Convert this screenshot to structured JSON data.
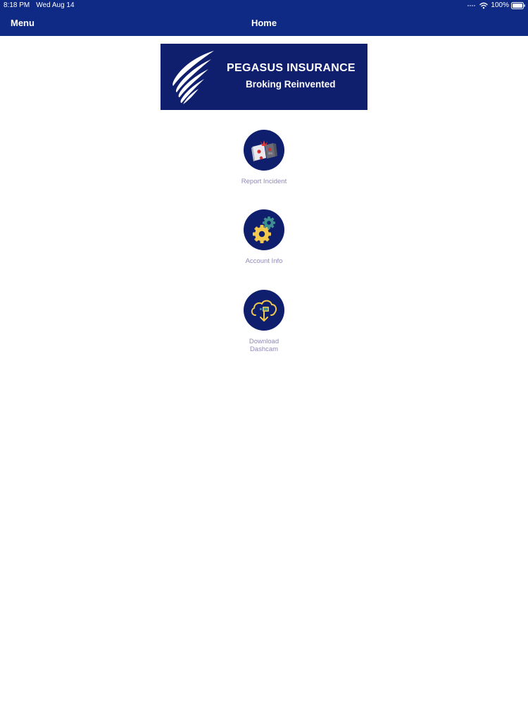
{
  "status_bar": {
    "time": "8:18 PM",
    "date": "Wed Aug 14",
    "battery": "100%"
  },
  "nav": {
    "menu_label": "Menu",
    "title": "Home"
  },
  "banner": {
    "title": "PEGASUS INSURANCE",
    "tagline": "Broking Reinvented"
  },
  "home_items": [
    {
      "label": "Report Incident",
      "icon": "car-crash-icon"
    },
    {
      "label": "Account Info",
      "icon": "gears-icon"
    },
    {
      "label": "Download Dashcam",
      "label_line1": "Download",
      "label_line2": "Dashcam",
      "icon": "cloud-download-icon"
    }
  ],
  "colors": {
    "header_bg": "#0e2a84",
    "banner_bg": "#0f1f6e",
    "icon_circle": "#0f1f6e",
    "label_text": "#8e8ab8",
    "gear_yellow": "#f2c94c",
    "gear_teal": "#3f8f8f"
  }
}
